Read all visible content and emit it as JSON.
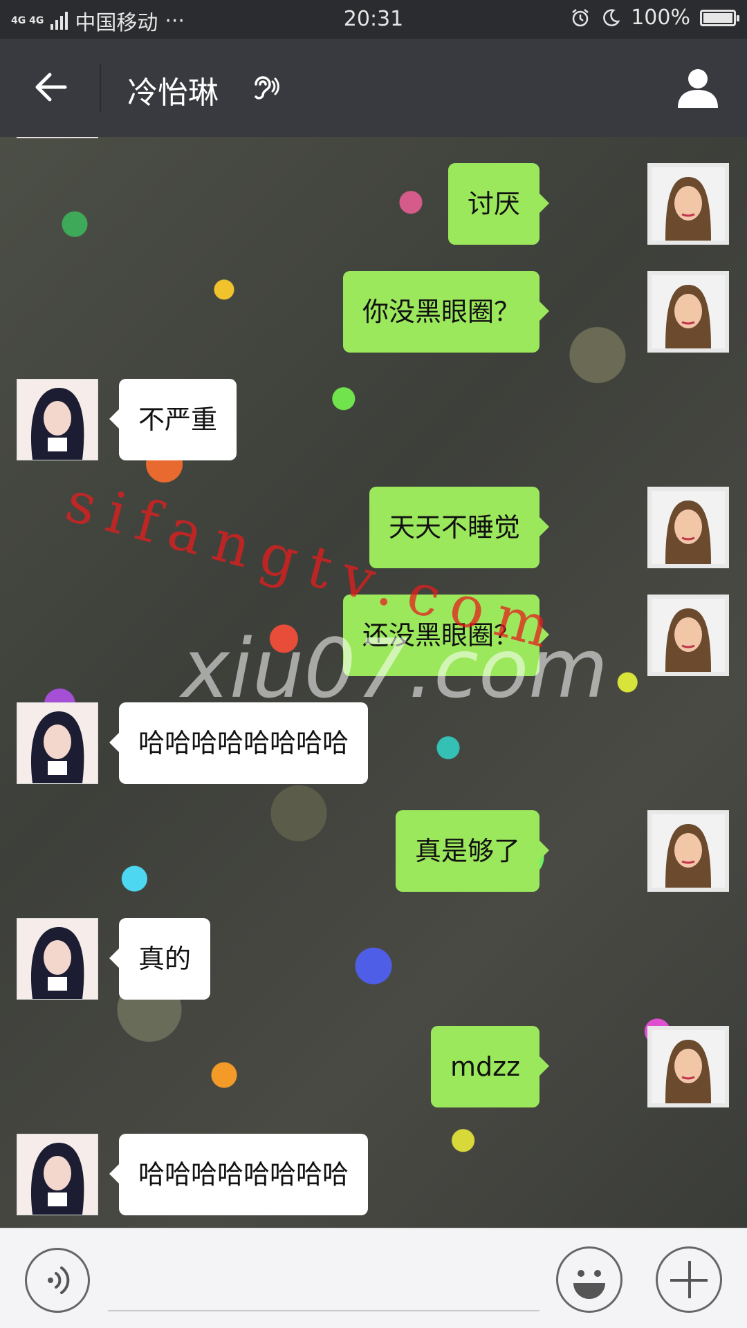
{
  "status_bar": {
    "network": "4G 4G",
    "carrier": "中国移动",
    "more": "···",
    "time": "20:31",
    "battery_label": "100%",
    "battery_level": 1.0,
    "icons": [
      "alarm-icon",
      "moon-icon",
      "battery-icon"
    ]
  },
  "header": {
    "title": "冷怡琳",
    "icons": [
      "back-arrow-icon",
      "ear-icon",
      "profile-icon"
    ]
  },
  "messages": [
    {
      "side": "me",
      "text": "讨厌"
    },
    {
      "side": "me",
      "text": "你没黑眼圈？"
    },
    {
      "side": "friend",
      "text": "不严重"
    },
    {
      "side": "me",
      "text": "天天不睡觉"
    },
    {
      "side": "me",
      "text": "还没黑眼圈？"
    },
    {
      "side": "friend",
      "text": "哈哈哈哈哈哈哈哈"
    },
    {
      "side": "me",
      "text": "真是够了"
    },
    {
      "side": "friend",
      "text": "真的"
    },
    {
      "side": "me",
      "text": "mdzz"
    },
    {
      "side": "friend",
      "text": "哈哈哈哈哈哈哈哈"
    }
  ],
  "watermarks": {
    "red": "sifangtv.com",
    "white": "xiu07.com"
  },
  "input_bar": {
    "icons": [
      "voice-icon",
      "emoji-icon",
      "plus-icon"
    ],
    "input_value": ""
  },
  "colors": {
    "header_bg": "#393a3f",
    "my_bubble": "#9ce85c",
    "friend_bubble": "#ffffff"
  }
}
